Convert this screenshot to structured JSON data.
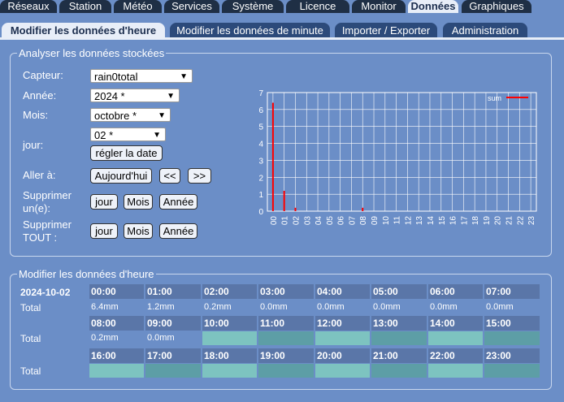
{
  "nav_main": [
    {
      "label": "Réseaux",
      "active": false
    },
    {
      "label": "Station",
      "active": false
    },
    {
      "label": "Météo",
      "active": false
    },
    {
      "label": "Services",
      "active": false
    },
    {
      "label": "Système",
      "active": false
    },
    {
      "label": "Licence",
      "active": false
    },
    {
      "label": "Monitor",
      "active": false
    },
    {
      "label": "Données",
      "active": true
    },
    {
      "label": "Graphiques",
      "active": false
    }
  ],
  "nav_sub": [
    {
      "label": "Modifier les données d'heure",
      "active": true
    },
    {
      "label": "Modifier les données de minute",
      "active": false
    },
    {
      "label": "Importer / Exporter",
      "active": false
    },
    {
      "label": "Administration",
      "active": false
    }
  ],
  "analyse": {
    "legend": "Analyser les données stockées",
    "capteur_label": "Capteur:",
    "capteur_value": "rain0total",
    "annee_label": "Année:",
    "annee_value": "2024 *",
    "mois_label": "Mois:",
    "mois_value": "octobre *",
    "jour_label": "jour:",
    "jour_value": "02 *",
    "set_date_button": "régler la date",
    "goto_label": "Aller à:",
    "today_button": "Aujourd'hui",
    "prev_button": "<<",
    "next_button": ">>",
    "delete_one_label_1": "Supprimer",
    "delete_one_label_2": "un(e):",
    "delete_all_label_1": "Supprimer",
    "delete_all_label_2": "TOUT :",
    "day_button": "jour",
    "month_button": "Mois",
    "year_button": "Année"
  },
  "chart_data": {
    "type": "bar",
    "categories": [
      "00",
      "01",
      "02",
      "03",
      "04",
      "05",
      "06",
      "07",
      "08",
      "09",
      "10",
      "11",
      "12",
      "13",
      "14",
      "15",
      "16",
      "17",
      "18",
      "19",
      "20",
      "21",
      "22",
      "23"
    ],
    "series": [
      {
        "name": "sum",
        "values": [
          6.4,
          1.2,
          0.2,
          0,
          0,
          0,
          0,
          0,
          0.2,
          0,
          0,
          0,
          0,
          0,
          0,
          0,
          0,
          0,
          0,
          0,
          0,
          0,
          0,
          0
        ]
      }
    ],
    "ylim": [
      0,
      7
    ],
    "yticks": [
      "0",
      "1",
      "2",
      "3",
      "4",
      "5",
      "6",
      "7"
    ],
    "grid": true,
    "legend_position": "top-right",
    "series_color": "#ff0000"
  },
  "hours": {
    "legend": "Modifier les données d'heure",
    "date": "2024-10-02",
    "total_label": "Total",
    "hours": [
      "00:00",
      "01:00",
      "02:00",
      "03:00",
      "04:00",
      "05:00",
      "06:00",
      "07:00",
      "08:00",
      "09:00",
      "10:00",
      "11:00",
      "12:00",
      "13:00",
      "14:00",
      "15:00",
      "16:00",
      "17:00",
      "18:00",
      "19:00",
      "20:00",
      "21:00",
      "22:00",
      "23:00"
    ],
    "values": [
      "6.4mm",
      "1.2mm",
      "0.2mm",
      "0.0mm",
      "0.0mm",
      "0.0mm",
      "0.0mm",
      "0.0mm",
      "0.2mm",
      "0.0mm",
      "",
      "",
      "",
      "",
      "",
      "",
      "",
      "",
      "",
      "",
      "",
      "",
      "",
      ""
    ]
  }
}
